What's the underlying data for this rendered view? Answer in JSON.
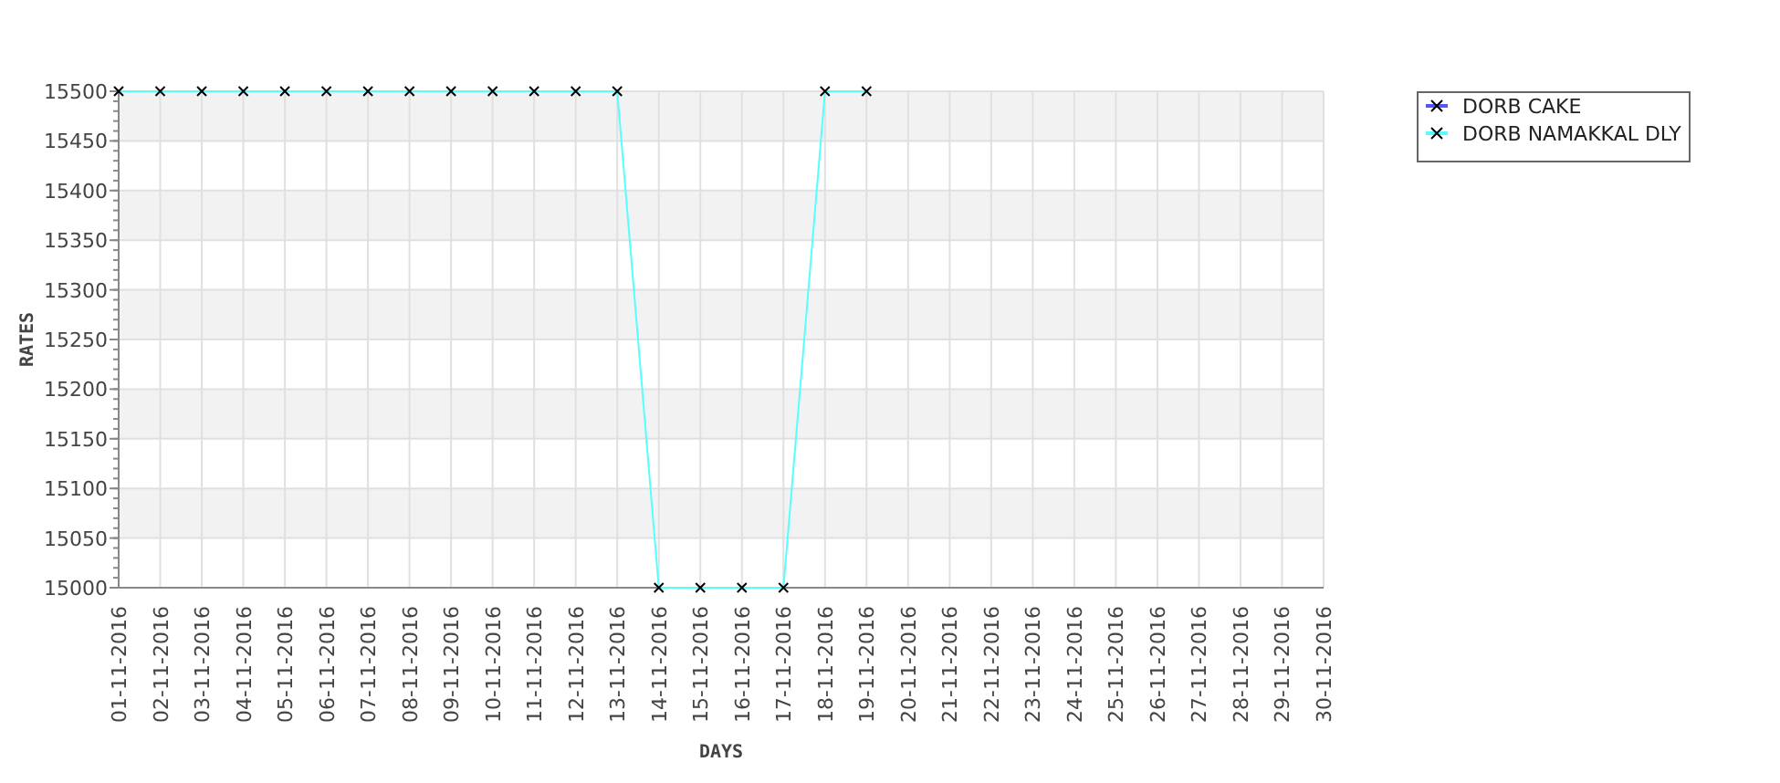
{
  "chart_data": {
    "type": "line",
    "grid": true,
    "legend": true,
    "xlabel": "DAYS",
    "ylabel": "RATES",
    "ylim": [
      15000,
      15500
    ],
    "yticks": [
      15000,
      15050,
      15100,
      15150,
      15200,
      15250,
      15300,
      15350,
      15400,
      15450,
      15500
    ],
    "categories": [
      "01-11-2016",
      "02-11-2016",
      "03-11-2016",
      "04-11-2016",
      "05-11-2016",
      "06-11-2016",
      "07-11-2016",
      "08-11-2016",
      "09-11-2016",
      "10-11-2016",
      "11-11-2016",
      "12-11-2016",
      "13-11-2016",
      "14-11-2016",
      "15-11-2016",
      "16-11-2016",
      "17-11-2016",
      "18-11-2016",
      "19-11-2016",
      "20-11-2016",
      "21-11-2016",
      "22-11-2016",
      "23-11-2016",
      "24-11-2016",
      "25-11-2016",
      "26-11-2016",
      "27-11-2016",
      "28-11-2016",
      "29-11-2016",
      "30-11-2016"
    ],
    "series": [
      {
        "name": "DORB CAKE",
        "color": "#5555ff",
        "marker": "x",
        "values": [
          null,
          null,
          null,
          null,
          null,
          null,
          null,
          null,
          null,
          null,
          null,
          null,
          null,
          null,
          null,
          null,
          null,
          null,
          null,
          null,
          null,
          null,
          null,
          null,
          null,
          null,
          null,
          null,
          null,
          null
        ]
      },
      {
        "name": "DORB NAMAKKAL DLY",
        "color": "#55ffff",
        "marker": "x",
        "values": [
          15500,
          15500,
          15500,
          15500,
          15500,
          15500,
          15500,
          15500,
          15500,
          15500,
          15500,
          15500,
          15500,
          15000,
          15000,
          15000,
          15000,
          15500,
          15500,
          null,
          null,
          null,
          null,
          null,
          null,
          null,
          null,
          null,
          null,
          null
        ]
      }
    ]
  }
}
